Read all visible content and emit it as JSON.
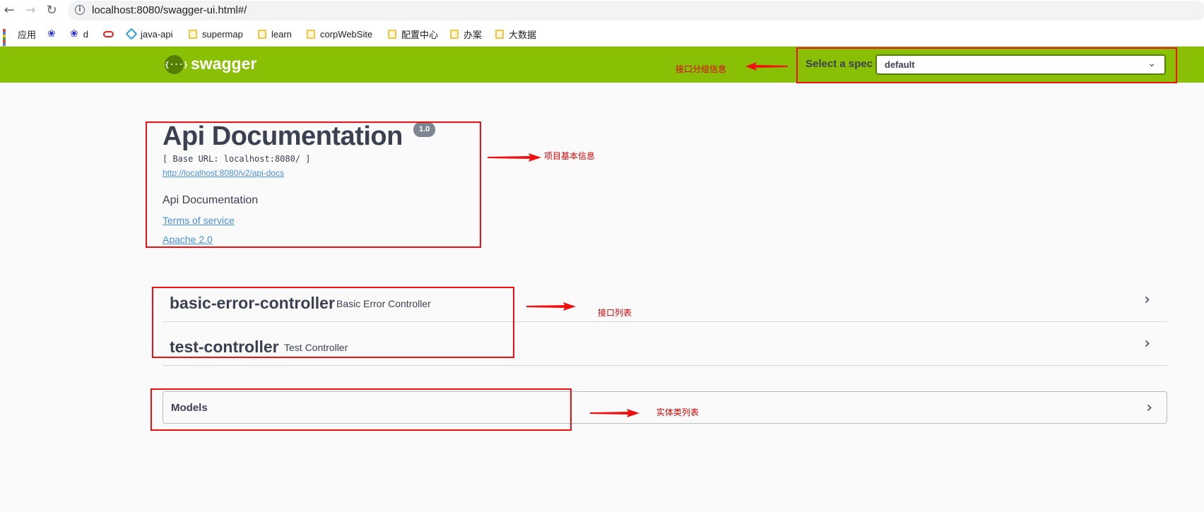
{
  "browser": {
    "url": "localhost:8080/swagger-ui.html#/",
    "bookmarks": [
      {
        "label": "应用",
        "icon": "apps-grid-icon"
      },
      {
        "label": "",
        "icon": "baidu-paw-icon"
      },
      {
        "label": "d",
        "icon": "baidu-paw-icon"
      },
      {
        "label": "",
        "icon": "red-oval-icon"
      },
      {
        "label": "java-api",
        "icon": "diamond-icon"
      },
      {
        "label": "supermap",
        "icon": "folder-icon"
      },
      {
        "label": "learn",
        "icon": "folder-icon"
      },
      {
        "label": "corpWebSite",
        "icon": "folder-icon"
      },
      {
        "label": "配置中心",
        "icon": "folder-icon"
      },
      {
        "label": "办案",
        "icon": "folder-icon"
      },
      {
        "label": "大数据",
        "icon": "folder-icon"
      }
    ]
  },
  "topbar": {
    "logo_symbol": "{···}",
    "logo_text": "swagger",
    "spec_label": "Select a spec",
    "spec_value": "default",
    "color": "#89bf04"
  },
  "info": {
    "title": "Api Documentation",
    "version": "1.0",
    "base_url": "[ Base URL: localhost:8080/ ]",
    "docs_link": "http://localhost:8080/v2/api-docs",
    "description": "Api Documentation",
    "terms": "Terms of service",
    "license": "Apache 2.0"
  },
  "tags": [
    {
      "name": "basic-error-controller",
      "description": "Basic Error Controller"
    },
    {
      "name": "test-controller",
      "description": "Test Controller"
    }
  ],
  "models": {
    "label": "Models"
  },
  "annotations": {
    "group_info": "接口分组信息",
    "project_info": "项目基本信息",
    "api_list": "接口列表",
    "entity_list": "实体类列表",
    "color": "#f01010"
  }
}
